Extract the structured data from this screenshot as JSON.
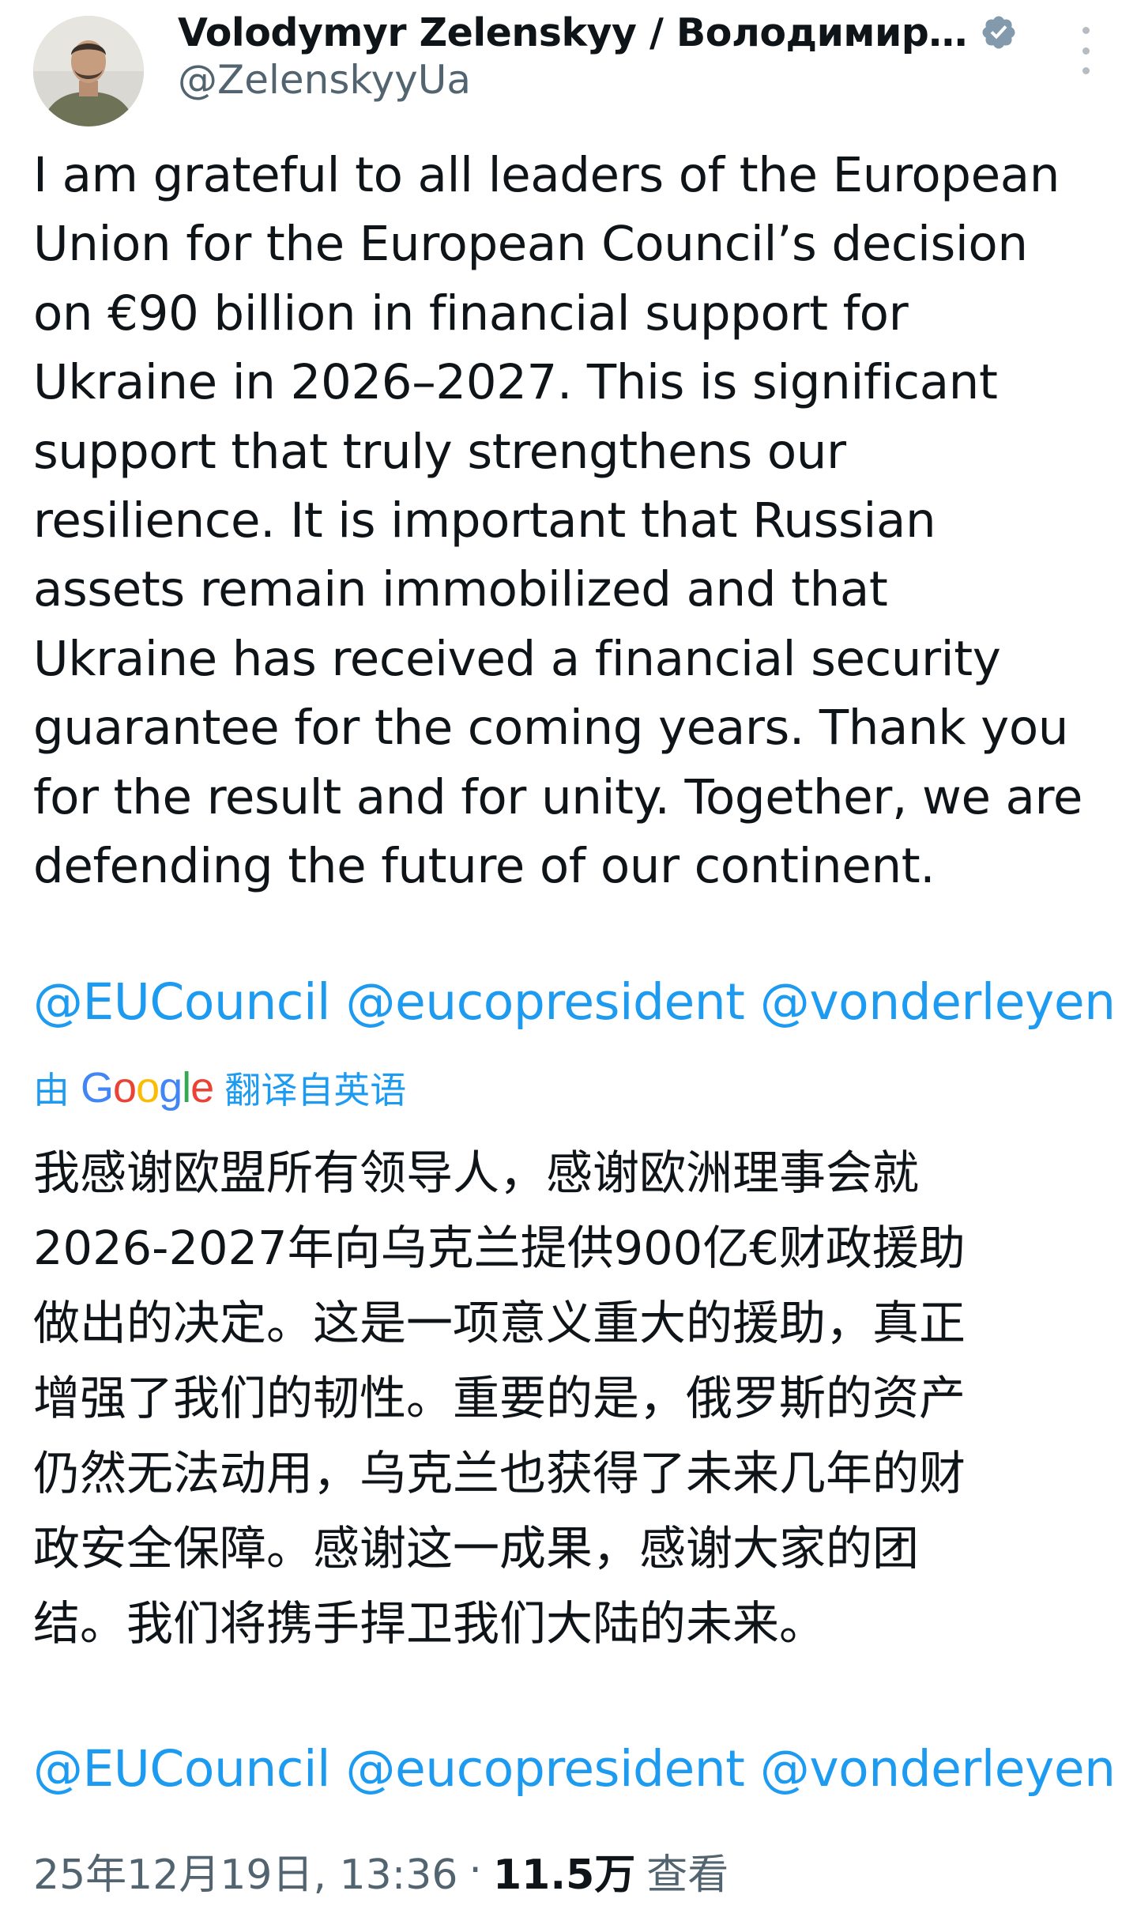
{
  "author": {
    "display_name": "Volodymyr Zelenskyy / Володимир…",
    "handle": "@ZelenskyyUa",
    "verified": true
  },
  "tweet": {
    "text": "I am grateful to all leaders of the European\nUnion for the European Council’s decision\non €90 billion in financial support for\nUkraine in 2026–2027. This is significant\nsupport that truly strengthens our\nresilience. It is important that Russian\nassets remain immobilized and that\nUkraine has received a financial security\nguarantee for the coming years. Thank you\nfor the result and for unity. Together, we are\ndefending the future of our continent.",
    "mentions": [
      "@EUCouncil",
      "@eucopresident",
      "@vonderleyen"
    ]
  },
  "translation": {
    "prefix": "由",
    "provider_logo": "Google",
    "suffix": "翻译自英语",
    "text": "我感谢欧盟所有领导人，感谢欧洲理事会就\n2026-2027年向乌克兰提供900亿€财政援助\n做出的决定。这是一项意义重大的援助，真正\n增强了我们的韧性。重要的是，俄罗斯的资产\n仍然无法动用，乌克兰也获得了未来几年的财\n政安全保障。感谢这一成果，感谢大家的团\n结。我们将携手捍卫我们大陆的未来。",
    "mentions": [
      "@EUCouncil",
      "@eucopresident",
      "@vonderleyen"
    ]
  },
  "meta": {
    "timestamp": "25年12月19日, 13:36",
    "separator": "·",
    "views_count": "11.5万",
    "views_label": "查看"
  },
  "colors": {
    "link": "#1d9bf0",
    "secondary_text": "#536471",
    "primary_text": "#0f1419",
    "verified_badge": "#829aab"
  },
  "icons": {
    "verified": "verified-badge-icon",
    "more": "more-options-icon"
  }
}
